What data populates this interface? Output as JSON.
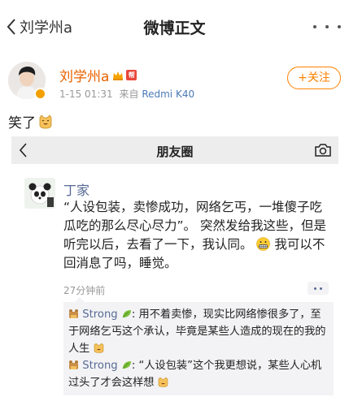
{
  "nav": {
    "back_label": "刘学州a",
    "title": "微博正文"
  },
  "author": {
    "name": "刘学州a",
    "vip_tag": "帮",
    "time": "1-15 01:31",
    "source_prefix": "来自",
    "source": "Redmi K40",
    "follow_label": "+关注"
  },
  "post": {
    "text": "笑了"
  },
  "screenshot": {
    "title": "朋友圈",
    "moment": {
      "name": "丁家",
      "text_part1": "“人设包装，卖惨成功，网络乞丐，一堆傻子吃瓜吃的那么尽心尽力”。 突然发给我这些，但是听完以后，去看了一下，我认同。",
      "text_part2": "我可以不回消息了吗，睡觉。",
      "time": "27分钟前"
    },
    "comments": [
      {
        "user": "Strong",
        "text": ": 用不着卖惨，现实比网络惨很多了，至于网络乞丐这个承认，毕竟是某些人造成的现在的我的人生"
      },
      {
        "user": "Strong",
        "text": ": “人设包装”这个我更想说，某些人心机过头了才会这样想"
      }
    ]
  },
  "colors": {
    "accent_orange": "#ff8200",
    "name_orange": "#ea6200",
    "wechat_blue": "#576b95"
  }
}
